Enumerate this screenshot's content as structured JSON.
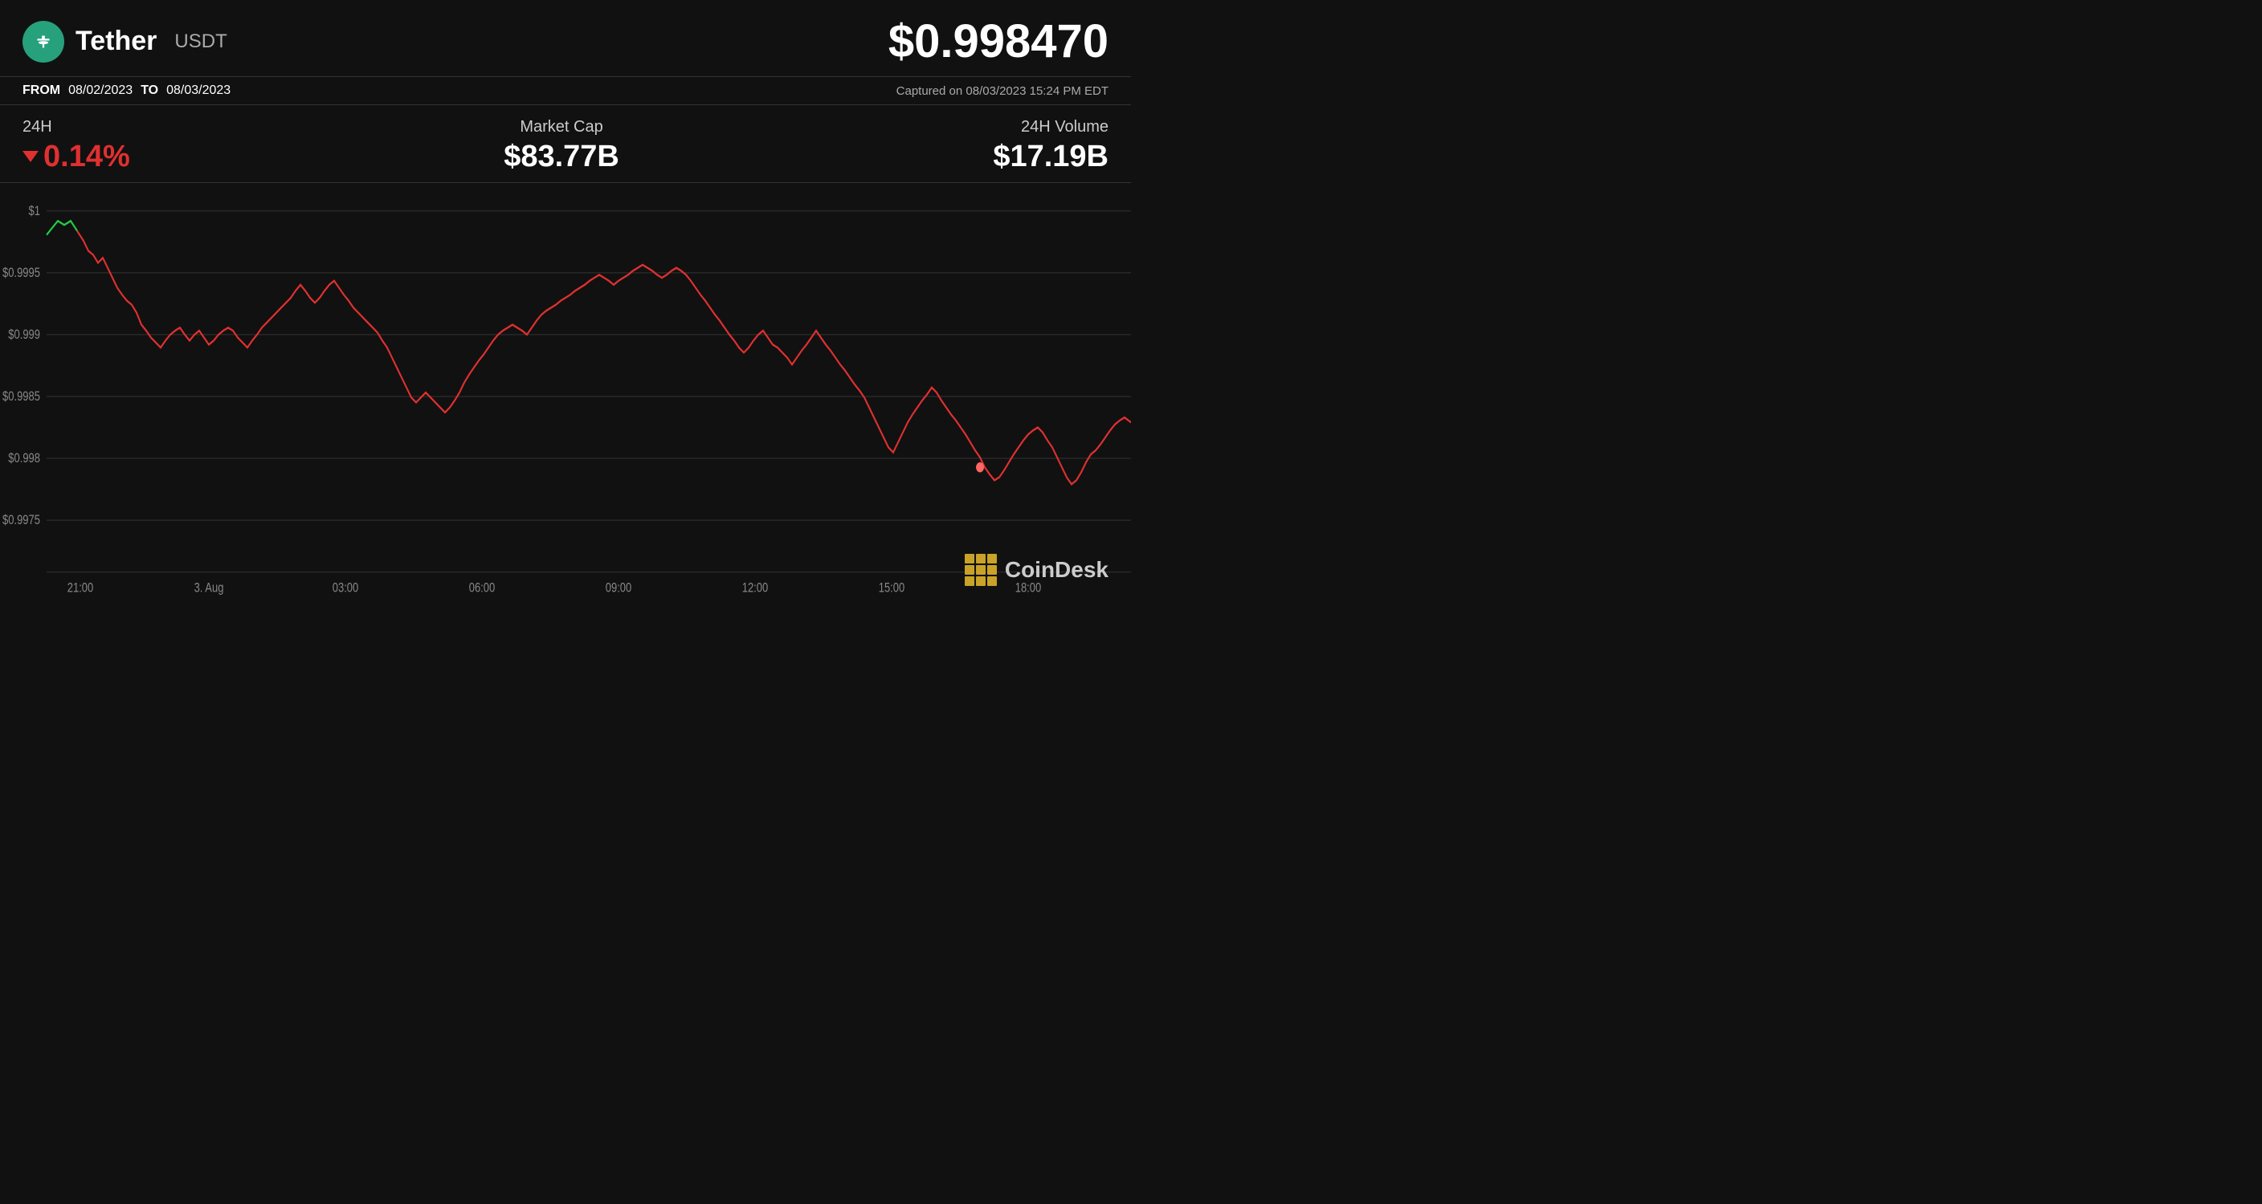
{
  "header": {
    "coin_name": "Tether",
    "coin_ticker": "USDT",
    "current_price": "$0.998470"
  },
  "dates": {
    "from_label": "FROM",
    "from_value": "08/02/2023",
    "to_label": "TO",
    "to_value": "08/03/2023",
    "captured": "Captured on 08/03/2023 15:24 PM EDT"
  },
  "stats": {
    "change_label": "24H",
    "change_value": "0.14%",
    "marketcap_label": "Market Cap",
    "marketcap_value": "$83.77B",
    "volume_label": "24H Volume",
    "volume_value": "$17.19B"
  },
  "chart": {
    "y_labels": [
      "$1",
      "$0.9995",
      "$0.999",
      "$0.9985",
      "$0.998",
      "$0.9975"
    ],
    "x_labels": [
      "21:00",
      "3. Aug",
      "03:00",
      "06:00",
      "09:00",
      "12:00",
      "15:00",
      "18:00"
    ],
    "accent_color": "#e03030",
    "start_color": "#22cc44"
  },
  "branding": {
    "coindesk_label": "CoinDesk"
  }
}
